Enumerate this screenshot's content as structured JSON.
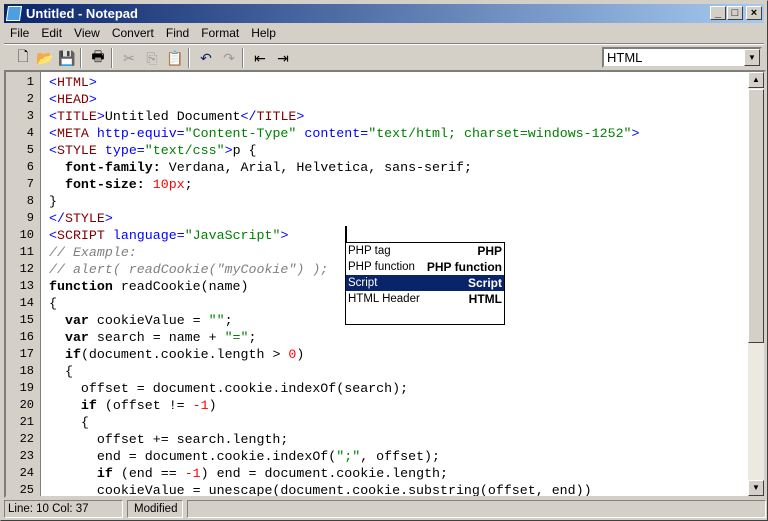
{
  "window": {
    "title": "Untitled - Notepad",
    "minimize": "_",
    "maximize": "□",
    "close": "×"
  },
  "menu": [
    "File",
    "Edit",
    "View",
    "Convert",
    "Find",
    "Format",
    "Help"
  ],
  "toolbar": {
    "icons": [
      "new-icon",
      "open-icon",
      "save-icon",
      "print-icon",
      "cut-icon",
      "copy-icon",
      "paste-icon",
      "undo-icon",
      "redo-icon",
      "indent-icon",
      "outdent-icon"
    ],
    "glyphs": [
      "🗋",
      "📂",
      "💾",
      "🖶",
      "✂",
      "⎘",
      "📋",
      "↶",
      "↷",
      "⇤",
      "⇥"
    ],
    "language": "HTML"
  },
  "code": [
    [
      [
        "p",
        "<"
      ],
      [
        "t",
        "HTML"
      ],
      [
        "p",
        ">"
      ]
    ],
    [
      [
        "p",
        "<"
      ],
      [
        "t",
        "HEAD"
      ],
      [
        "p",
        ">"
      ]
    ],
    [
      [
        "p",
        "<"
      ],
      [
        "t",
        "TITLE"
      ],
      [
        "p",
        ">"
      ],
      [
        "x",
        "Untitled Document"
      ],
      [
        "p",
        "</"
      ],
      [
        "t",
        "TITLE"
      ],
      [
        "p",
        ">"
      ]
    ],
    [
      [
        "p",
        "<"
      ],
      [
        "t",
        "META"
      ],
      [
        "x",
        " "
      ],
      [
        "a",
        "http-equiv="
      ],
      [
        "s",
        "\"Content-Type\""
      ],
      [
        "x",
        " "
      ],
      [
        "a",
        "content="
      ],
      [
        "s",
        "\"text/html; charset=windows-1252\""
      ],
      [
        "p",
        ">"
      ]
    ],
    [
      [
        "p",
        "<"
      ],
      [
        "t",
        "STYLE"
      ],
      [
        "x",
        " "
      ],
      [
        "a",
        "type="
      ],
      [
        "s",
        "\"text/css\""
      ],
      [
        "p",
        ">"
      ],
      [
        "x",
        "p {"
      ]
    ],
    [
      [
        "x",
        "  "
      ],
      [
        "k",
        "font-family:"
      ],
      [
        "x",
        " Verdana, Arial, Helvetica, sans-serif;"
      ]
    ],
    [
      [
        "x",
        "  "
      ],
      [
        "k",
        "font-size:"
      ],
      [
        "x",
        " "
      ],
      [
        "n",
        "10px"
      ],
      [
        "x",
        ";"
      ]
    ],
    [
      [
        "x",
        "}"
      ]
    ],
    [
      [
        "p",
        "</"
      ],
      [
        "t",
        "STYLE"
      ],
      [
        "p",
        ">"
      ]
    ],
    [
      [
        "p",
        "<"
      ],
      [
        "t",
        "SCRIPT"
      ],
      [
        "x",
        " "
      ],
      [
        "a",
        "language="
      ],
      [
        "s",
        "\"JavaScript\""
      ],
      [
        "p",
        ">"
      ]
    ],
    [
      [
        "c",
        "// Example:"
      ]
    ],
    [
      [
        "c",
        "// alert( readCookie(\"myCookie\") );"
      ]
    ],
    [
      [
        "k",
        "function"
      ],
      [
        "x",
        " readCookie(name)"
      ]
    ],
    [
      [
        "x",
        "{"
      ]
    ],
    [
      [
        "x",
        "  "
      ],
      [
        "k",
        "var"
      ],
      [
        "x",
        " cookieValue = "
      ],
      [
        "s",
        "\"\""
      ],
      [
        "x",
        ";"
      ]
    ],
    [
      [
        "x",
        "  "
      ],
      [
        "k",
        "var"
      ],
      [
        "x",
        " search = name + "
      ],
      [
        "s",
        "\"=\""
      ],
      [
        "x",
        ";"
      ]
    ],
    [
      [
        "x",
        "  "
      ],
      [
        "k",
        "if"
      ],
      [
        "x",
        "(document.cookie.length > "
      ],
      [
        "n",
        "0"
      ],
      [
        "x",
        ")"
      ]
    ],
    [
      [
        "x",
        "  {"
      ]
    ],
    [
      [
        "x",
        "    offset = document.cookie.indexOf(search);"
      ]
    ],
    [
      [
        "x",
        "    "
      ],
      [
        "k",
        "if"
      ],
      [
        "x",
        " (offset != "
      ],
      [
        "n",
        "-1"
      ],
      [
        "x",
        ")"
      ]
    ],
    [
      [
        "x",
        "    {"
      ]
    ],
    [
      [
        "x",
        "      offset += search.length;"
      ]
    ],
    [
      [
        "x",
        "      end = document.cookie.indexOf("
      ],
      [
        "s",
        "\";\""
      ],
      [
        "x",
        ", offset);"
      ]
    ],
    [
      [
        "x",
        "      "
      ],
      [
        "k",
        "if"
      ],
      [
        "x",
        " (end == "
      ],
      [
        "n",
        "-1"
      ],
      [
        "x",
        ") end = document.cookie.length;"
      ]
    ],
    [
      [
        "x",
        "      cookieValue = unescape(document.cookie.substring(offset, end))"
      ]
    ]
  ],
  "autocomplete": [
    {
      "label": "PHP tag",
      "value": "PHP"
    },
    {
      "label": "PHP function",
      "value": "PHP function"
    },
    {
      "label": "Script",
      "value": "Script",
      "selected": true
    },
    {
      "label": "HTML Header",
      "value": "HTML"
    }
  ],
  "status": {
    "line_col": "Line:  10   Col:  37",
    "modified": "Modified"
  },
  "colors": {
    "title_start": "#0a246a",
    "selection": "#0a246a",
    "tag": "#800000",
    "attr": "#0000ff",
    "string": "#008000",
    "number": "#ff0000",
    "comment": "#808080"
  }
}
